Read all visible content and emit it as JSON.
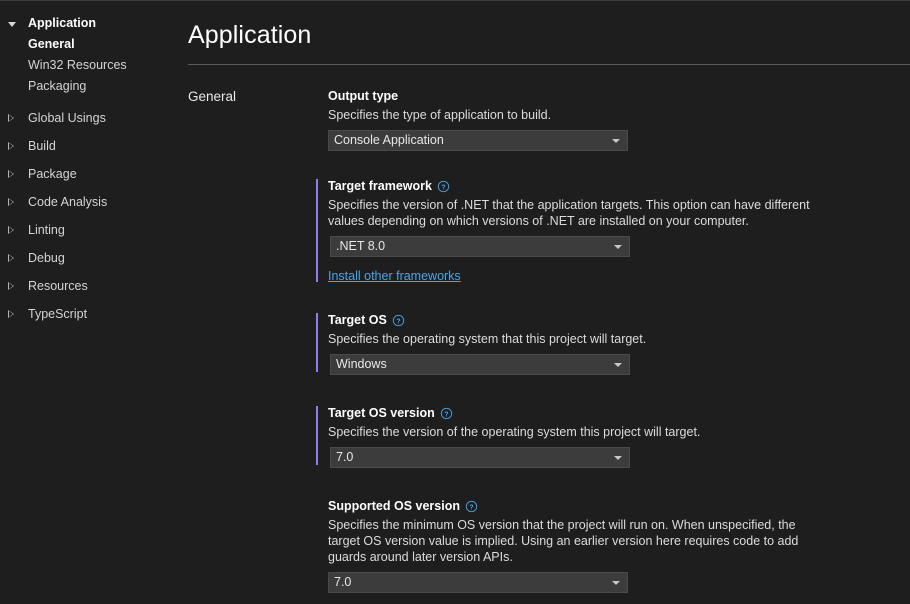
{
  "sidebar": {
    "root": {
      "label": "Application",
      "expanded": true,
      "glyph": "triangle-down-icon"
    },
    "children": [
      {
        "label": "General",
        "selected": true
      },
      {
        "label": "Win32 Resources",
        "selected": false
      },
      {
        "label": "Packaging",
        "selected": false
      }
    ],
    "items": [
      {
        "label": "Global Usings",
        "glyph": "triangle-right-icon"
      },
      {
        "label": "Build",
        "glyph": "triangle-right-icon"
      },
      {
        "label": "Package",
        "glyph": "triangle-right-icon"
      },
      {
        "label": "Code Analysis",
        "glyph": "triangle-right-icon"
      },
      {
        "label": "Linting",
        "glyph": "triangle-right-icon"
      },
      {
        "label": "Debug",
        "glyph": "triangle-right-icon"
      },
      {
        "label": "Resources",
        "glyph": "triangle-right-icon"
      },
      {
        "label": "TypeScript",
        "glyph": "triangle-right-icon"
      }
    ]
  },
  "header": {
    "title": "Application"
  },
  "section": {
    "label": "General"
  },
  "fields": {
    "output_type": {
      "title": "Output type",
      "description": "Specifies the type of application to build.",
      "value": "Console Application",
      "has_help": false,
      "accent": false
    },
    "target_framework": {
      "title": "Target framework",
      "help_icon": "help-circle-icon",
      "description": "Specifies the version of .NET that the application targets. This option can have different values depending on which versions of .NET are installed on your computer.",
      "value": ".NET 8.0",
      "has_help": true,
      "accent": true,
      "link": "Install other frameworks"
    },
    "target_os": {
      "title": "Target OS",
      "help_icon": "help-circle-icon",
      "description": "Specifies the operating system that this project will target.",
      "value": "Windows",
      "has_help": true,
      "accent": true
    },
    "target_os_version": {
      "title": "Target OS version",
      "help_icon": "help-circle-icon",
      "description": "Specifies the version of the operating system this project will target.",
      "value": "7.0",
      "has_help": true,
      "accent": true
    },
    "supported_os_version": {
      "title": "Supported OS version",
      "help_icon": "help-circle-icon",
      "description": "Specifies the minimum OS version that the project will run on. When unspecified, the target OS version value is implied. Using an earlier version here requires code to add guards around later version APIs.",
      "value": "7.0",
      "has_help": true,
      "accent": false
    }
  },
  "colors": {
    "background": "#1e1e1e",
    "accent_bar": "#8b7fe8",
    "link": "#4aa5e8",
    "help_icon": "#4aa5e8",
    "combo_bg": "#3c3c3c",
    "rule": "#5a5a5a"
  }
}
